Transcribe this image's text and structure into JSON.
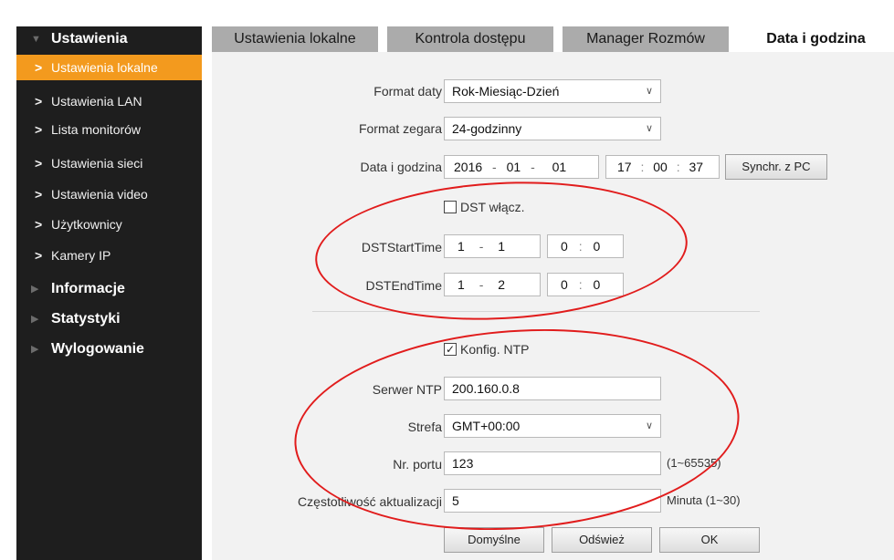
{
  "sidebar": {
    "groups": [
      {
        "label": "Ustawienia",
        "expanded": true
      },
      {
        "label": "Informacje",
        "expanded": false
      },
      {
        "label": "Statystyki",
        "expanded": false
      },
      {
        "label": "Wylogowanie",
        "expanded": false
      }
    ],
    "items": [
      {
        "label": "Ustawienia lokalne",
        "active": true
      },
      {
        "label": "Ustawienia LAN"
      },
      {
        "label": "Lista monitorów"
      },
      {
        "label": "Ustawienia sieci"
      },
      {
        "label": "Ustawienia video"
      },
      {
        "label": "Użytkownicy"
      },
      {
        "label": "Kamery IP"
      }
    ],
    "arrow": ">",
    "tri_expanded": "▼",
    "tri_collapsed": "▶"
  },
  "tabs": [
    {
      "label": "Ustawienia lokalne"
    },
    {
      "label": "Kontrola dostępu"
    },
    {
      "label": "Manager Rozmów"
    },
    {
      "label": "Data i godzina",
      "active": true
    }
  ],
  "form": {
    "date_format": {
      "label": "Format daty",
      "value": "Rok-Miesiąc-Dzień"
    },
    "clock_format": {
      "label": "Format zegara",
      "value": "24-godzinny"
    },
    "datetime": {
      "label": "Data i godzina",
      "year": "2016",
      "month": "01",
      "day": "01",
      "hour": "17",
      "minute": "00",
      "second": "37",
      "date_sep": "-",
      "time_sep": ":",
      "sync_label": "Synchr. z PC"
    },
    "dst": {
      "label": "DST włącz.",
      "checked": false,
      "start": {
        "label": "DSTStartTime",
        "month": "1",
        "day": "1",
        "hour": "0",
        "minute": "0"
      },
      "end": {
        "label": "DSTEndTime",
        "month": "1",
        "day": "2",
        "hour": "0",
        "minute": "0"
      }
    },
    "ntp": {
      "label": "Konfig. NTP",
      "checked": true,
      "server": {
        "label": "Serwer NTP",
        "value": "200.160.0.8"
      },
      "zone": {
        "label": "Strefa",
        "value": "GMT+00:00"
      },
      "port": {
        "label": "Nr. portu",
        "value": "123",
        "hint": "(1~65535)"
      },
      "interval": {
        "label": "Częstotliwość aktualizacji",
        "value": "5",
        "hint": "Minuta (1~30)"
      }
    },
    "buttons": {
      "default": "Domyślne",
      "refresh": "Odśwież",
      "ok": "OK"
    }
  },
  "colors": {
    "active_item": "#f39a1e",
    "sidebar_bg": "#1e1e1e",
    "annotation": "#e11c1c"
  },
  "icons": {
    "check": "✓",
    "chevron": "∨"
  }
}
